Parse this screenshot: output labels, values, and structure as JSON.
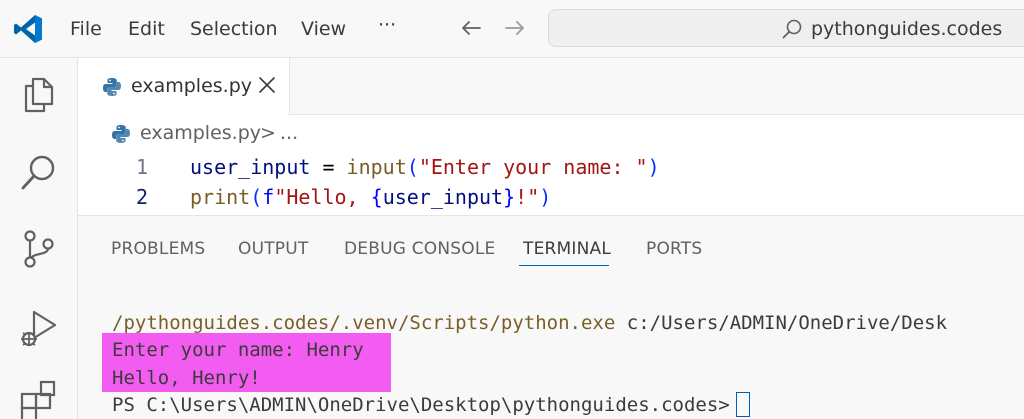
{
  "titlebar": {
    "menu": [
      "File",
      "Edit",
      "Selection",
      "View",
      "···"
    ],
    "search_text": "pythonguides.codes"
  },
  "activity_bar": {
    "icons": [
      "explorer-icon",
      "search-icon",
      "source-control-icon",
      "run-debug-icon",
      "extensions-icon"
    ]
  },
  "editor": {
    "tab_label": "examples.py",
    "breadcrumb": {
      "file": "examples.py",
      "separator": ">",
      "more": "..."
    },
    "line_numbers": [
      "1",
      "2"
    ],
    "code": {
      "line1": {
        "var": "user_input",
        "op": " = ",
        "fn": "input",
        "open": "(",
        "str": "\"Enter your name: \"",
        "close": ")"
      },
      "line2": {
        "fn": "print",
        "open": "(",
        "prefix": "f",
        "str_a": "\"Hello, ",
        "brace_open": "{",
        "var": "user_input",
        "brace_close": "}",
        "str_b": "!\"",
        "close": ")"
      }
    }
  },
  "panel": {
    "tabs": [
      "PROBLEMS",
      "OUTPUT",
      "DEBUG CONSOLE",
      "TERMINAL",
      "PORTS"
    ],
    "active_tab": "TERMINAL",
    "terminal": {
      "line1_path": "/pythonguides.codes/.venv/Scripts/python.exe",
      "line1_arg": " c:/Users/ADMIN/OneDrive/Desk",
      "line2": "Enter your name: Henry",
      "line3": "Hello, Henry!",
      "line4": "PS C:\\Users\\ADMIN\\OneDrive\\Desktop\\pythonguides.codes>"
    }
  },
  "colors": {
    "accent": "#005fb8",
    "vscode_blue": "#0065a9",
    "highlight": "#f35cf0"
  }
}
